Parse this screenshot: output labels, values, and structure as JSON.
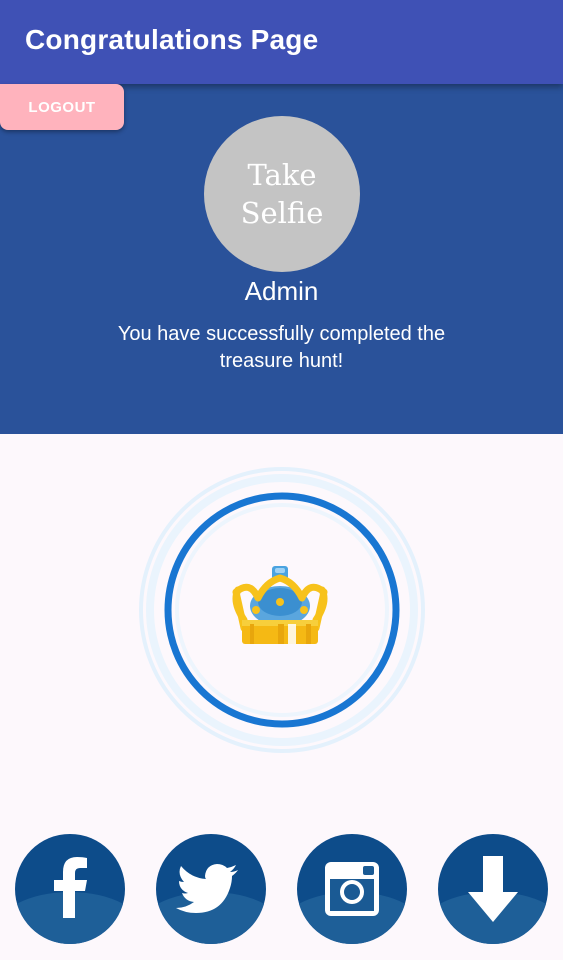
{
  "app_bar": {
    "title": "Congratulations Page",
    "color": "#3f51b5"
  },
  "profile": {
    "logout_label": "LOGOUT",
    "selfie_label": "Take Selfie",
    "username": "Admin",
    "message": "You have successfully completed the treasure hunt!",
    "background": "#2a529a"
  },
  "badge": {
    "icon": "crown-icon",
    "ring_color": "#1976d2"
  },
  "share": {
    "buttons": [
      {
        "icon": "facebook-icon"
      },
      {
        "icon": "twitter-icon"
      },
      {
        "icon": "instagram-icon"
      },
      {
        "icon": "download-icon"
      }
    ],
    "color": "#0d4c8a"
  }
}
